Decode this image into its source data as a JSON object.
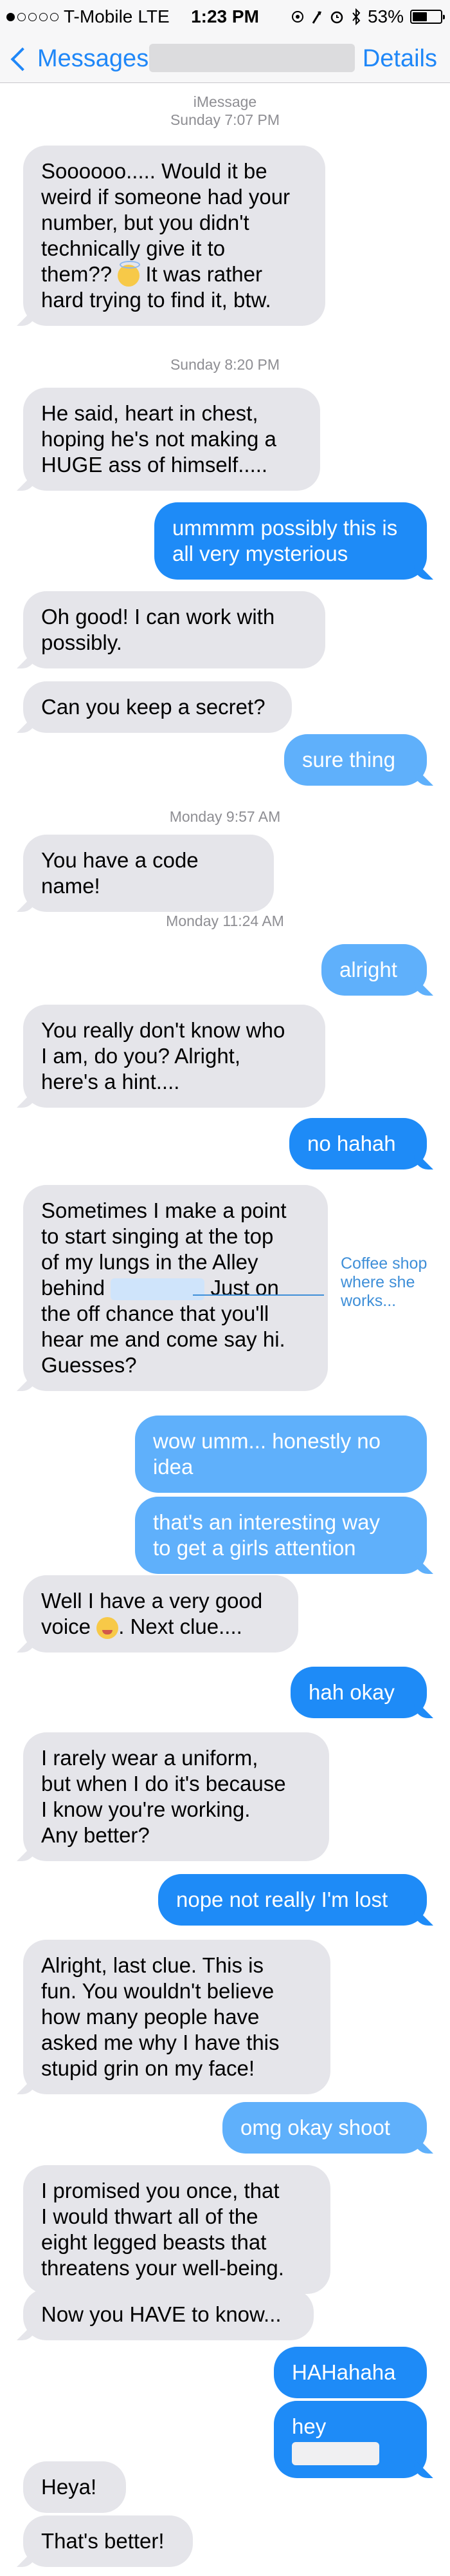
{
  "status_bar": {
    "carrier": "T-Mobile",
    "network": "LTE",
    "time": "1:23 PM",
    "battery": "53%",
    "battery_level": 0.53,
    "icons": [
      "signal-dots-icon",
      "location-icon",
      "alarm-icon",
      "bluetooth-icon",
      "battery-icon"
    ]
  },
  "nav": {
    "back_label": "Messages",
    "details_label": "Details"
  },
  "conversation": {
    "header_service": "iMessage",
    "header_time": "Sunday 7:07 PM",
    "msg1_a": "Soooooo..... Would it be\nweird if someone had your\nnumber, but you didn't\ntechnically give it to\nthem?? ",
    "msg1_b": " It was rather\nhard trying to find it, btw.",
    "ts2": "Sunday 8:20 PM",
    "msg2": "He said, heart in chest,\nhoping he's not making a\nHUGE ass of himself.....",
    "msg3": "ummmm possibly this is\nall very mysterious",
    "msg4": "Oh good!  I can work with\npossibly.",
    "msg5": "Can you keep a secret?",
    "msg6": "sure thing",
    "ts3": "Monday 9:57 AM",
    "msg7": "You have a code name!",
    "ts4": "Monday 11:24 AM",
    "msg8": "alright",
    "msg9": "You really don't know who\nI am, do you? Alright,\nhere's a hint....",
    "msg10": "no hahah",
    "msg11_a": "Sometimes I make a point\nto start singing at the top\nof my lungs in the Alley\nbehind",
    "msg11_b": "Just on\nthe off chance that you'll\nhear me and come say hi.\nGuesses?",
    "annotation": "Coffee shop\nwhere she\nworks...",
    "msg12": "wow umm... honestly no\nidea",
    "msg13": "that's an interesting way\nto get a girls attention",
    "msg14_a": "Well I have a very good\nvoice ",
    "msg14_b": ".  Next clue....",
    "msg15": "hah okay",
    "msg16": "I rarely wear a uniform,\nbut when I do it's because\nI know you're working.\nAny better?",
    "msg17": "nope not really I'm lost",
    "msg18": "Alright, last clue.  This is\nfun.  You wouldn't believe\nhow many people have\nasked me why I have this\nstupid grin on my face!",
    "msg19": "omg okay shoot",
    "msg20": "I promised you once, that\nI would thwart all of the\neight legged beasts that\nthreatens your well-being.",
    "msg21": "Now you HAVE to know...",
    "msg22": "HAHahaha",
    "msg23": "hey",
    "msg24": "Heya!",
    "msg25": "That's better!"
  },
  "colors": {
    "accent": "#1f87f8",
    "incoming_bubble": "#e5e5ea",
    "outgoing_bubble": "#1e8bf7",
    "annotation": "#3f8fd8"
  }
}
